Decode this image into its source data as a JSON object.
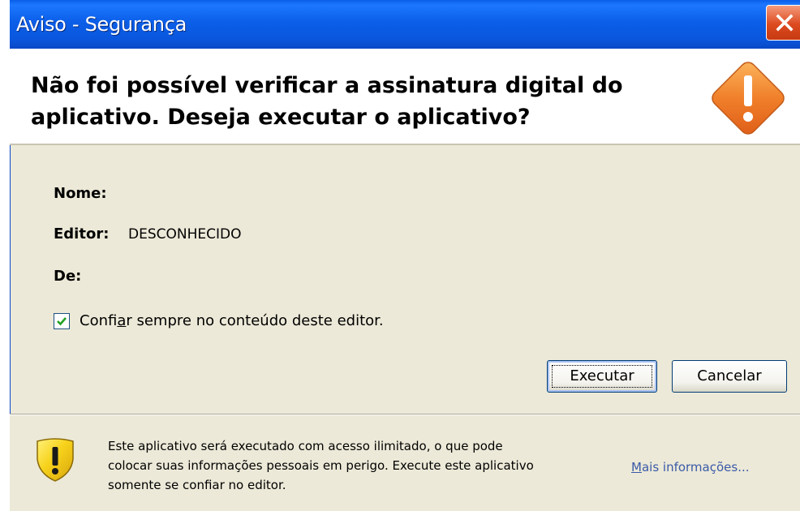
{
  "window": {
    "title": "Aviso - Segurança"
  },
  "header": {
    "line1": "Não foi possível verificar a assinatura digital do",
    "line2": "aplicativo.  Deseja executar o aplicativo?"
  },
  "fields": {
    "name_label": "Nome:",
    "editor_label": "Editor:",
    "editor_value": "DESCONHECIDO",
    "from_label": "De:"
  },
  "trust_checkbox": {
    "checked": true,
    "label_before": "Confi",
    "label_underlined": "a",
    "label_after": "r sempre no conteúdo deste editor."
  },
  "buttons": {
    "run": "Executar",
    "cancel": "Cancelar"
  },
  "footer": {
    "line1": "Este aplicativo será executado com acesso ilimitado, o que pode",
    "line2": "colocar suas informações pessoais em perigo. Execute este aplicativo",
    "line3": "somente se confiar no editor.",
    "link_underlined": "M",
    "link_rest": "ais informações..."
  },
  "icons": {
    "close": "close-icon",
    "warning": "warning-diamond-icon",
    "shield": "shield-warning-icon",
    "check": "check-icon"
  },
  "colors": {
    "titlebar": "#0a5de8",
    "close_button": "#dd4a1f",
    "warning_orange": "#f07f2a",
    "shield_yellow": "#f7d21b",
    "link": "#3a5aa8"
  }
}
